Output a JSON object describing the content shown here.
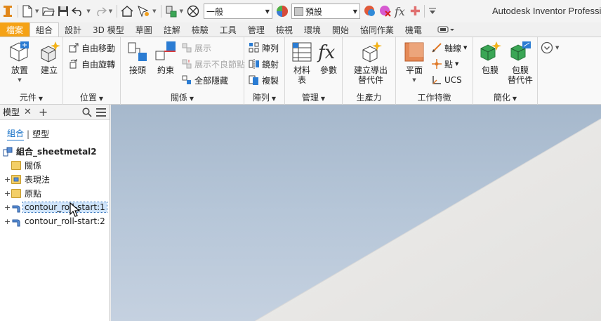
{
  "app": {
    "title": "Autodesk Inventor Professio"
  },
  "qat": {
    "material_value": "一般",
    "appearance_value": "預設",
    "fx_label": "fx"
  },
  "tabs": [
    "檔案",
    "組合",
    "設計",
    "3D 模型",
    "草圖",
    "註解",
    "檢驗",
    "工具",
    "管理",
    "檢視",
    "環境",
    "開始",
    "協同作業",
    "機電"
  ],
  "active_tab": "組合",
  "ribbon": {
    "component": {
      "place": "放置",
      "create": "建立",
      "label": "元件"
    },
    "position": {
      "free_move": "自由移動",
      "free_rotate": "自由旋轉",
      "label": "位置"
    },
    "relationships": {
      "joint": "接頭",
      "constrain": "約束",
      "show": "展示",
      "show_sick": "展示不良節點",
      "hide_all": "全部隱藏",
      "label": "關係"
    },
    "pattern": {
      "pattern": "陣列",
      "mirror": "鏡射",
      "copy": "複製",
      "label": "陣列"
    },
    "manage": {
      "bom_line1": "材料",
      "bom_line2": "表",
      "parameters": "參數",
      "label": "管理"
    },
    "productivity": {
      "derive_line1": "建立導出",
      "derive_line2": "替代件",
      "label": "生產力"
    },
    "work_features": {
      "plane": "平面",
      "axis": "軸線",
      "point": "點",
      "ucs": "UCS",
      "label": "工作特徵"
    },
    "simplification": {
      "shrinkwrap": "包膜",
      "shrink_sub_line1": "包膜",
      "shrink_sub_line2": "替代件",
      "label": "簡化"
    }
  },
  "browser": {
    "title": "模型",
    "tab_assembly": "組合",
    "tab_modeling": "塑型",
    "root": "組合_sheetmetal2",
    "items": [
      {
        "label": "關係",
        "expandable": false
      },
      {
        "label": "表現法",
        "expandable": true
      },
      {
        "label": "原點",
        "expandable": true
      },
      {
        "label": "contour_roll-start:1",
        "expandable": true,
        "selected": true
      },
      {
        "label": "contour_roll-start:2",
        "expandable": true,
        "selected": false
      }
    ]
  },
  "colors": {
    "file_tab": "#f5a216",
    "accent_blue": "#1a73c8",
    "viewport_top": "#a6b8cc",
    "part_surface": "#e9e8e6"
  }
}
